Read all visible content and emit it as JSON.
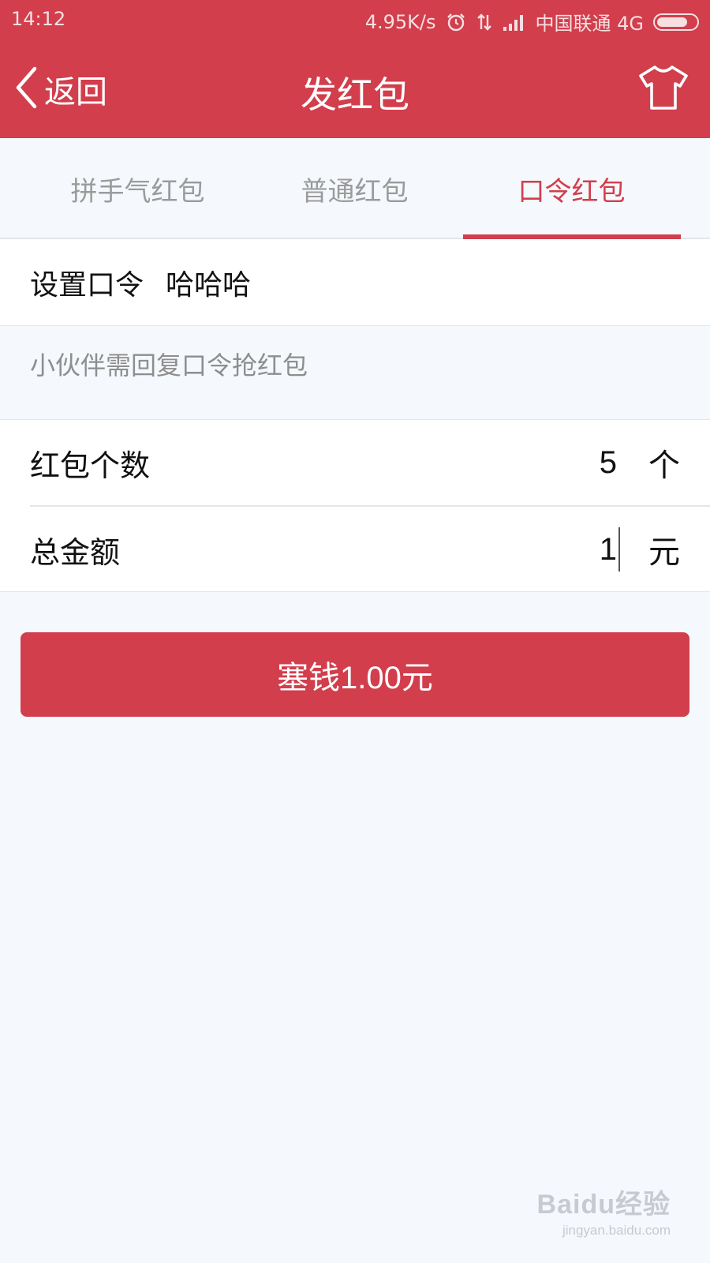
{
  "status_bar": {
    "time": "14:12",
    "network_speed": "4.95K/s",
    "carrier": "中国联通 4G",
    "battery_level": 0.8,
    "icons": [
      "alarm-icon",
      "data-transfer-icon",
      "signal-icon",
      "battery-icon"
    ]
  },
  "nav": {
    "back_label": "返回",
    "title": "发红包",
    "right_icon": "tshirt-icon"
  },
  "tabs": [
    {
      "label": "拼手气红包",
      "active": false
    },
    {
      "label": "普通红包",
      "active": false
    },
    {
      "label": "口令红包",
      "active": true
    }
  ],
  "password": {
    "label": "设置口令",
    "value": "哈哈哈"
  },
  "hint": "小伙伴需回复口令抢红包",
  "count": {
    "label": "红包个数",
    "value": "5",
    "unit": "个"
  },
  "amount": {
    "label": "总金额",
    "value": "1",
    "unit": "元"
  },
  "submit_label": "塞钱1.00元",
  "watermark": {
    "main": "Baidu经验",
    "sub": "jingyan.baidu.com"
  },
  "colors": {
    "accent": "#d23e4c",
    "background": "#f5f8fc",
    "tab_inactive": "#9b9b9b"
  }
}
